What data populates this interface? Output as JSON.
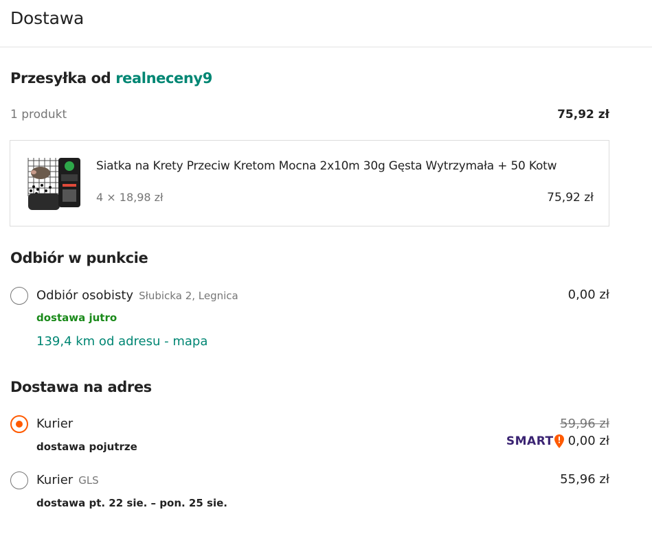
{
  "page": {
    "title": "Dostawa"
  },
  "shipment": {
    "title_prefix": "Przesyłka od ",
    "seller": "realneceny9",
    "products_count": "1 produkt",
    "products_total": "75,92 zł"
  },
  "product": {
    "name": "Siatka na Krety Przeciw Kretom Mocna 2x10m 30g Gęsta Wytrzymała + 50 Kotw",
    "unit_price": "4 × 18,98 zł",
    "price": "75,92 zł"
  },
  "pickup": {
    "section_title": "Odbiór w punkcie",
    "option": {
      "label": "Odbiór osobisty",
      "address": "Słubicka 2, Legnica",
      "eta": "dostawa jutro",
      "distance_link": "139,4 km od adresu - mapa",
      "price": "0,00 zł",
      "selected": false
    }
  },
  "address_delivery": {
    "section_title": "Dostawa na adres",
    "options": [
      {
        "label": "Kurier",
        "carrier": "",
        "eta": "dostawa pojutrze",
        "old_price": "59,96 zł",
        "smart_label": "SMART",
        "price": "0,00 zł",
        "selected": true
      },
      {
        "label": "Kurier",
        "carrier": "GLS",
        "eta": "dostawa pt. 22 sie. – pon. 25 sie.",
        "price": "55,96 zł",
        "selected": false
      }
    ]
  },
  "colors": {
    "accent": "#ff5a00",
    "link": "#008673",
    "eta_green": "#1a8a1a",
    "smart_purple": "#3a2372",
    "smart_orange": "#ff5a00",
    "muted": "#767676"
  },
  "icons": [
    "product-thumbnail",
    "radio-button",
    "smart-logo-icon"
  ]
}
